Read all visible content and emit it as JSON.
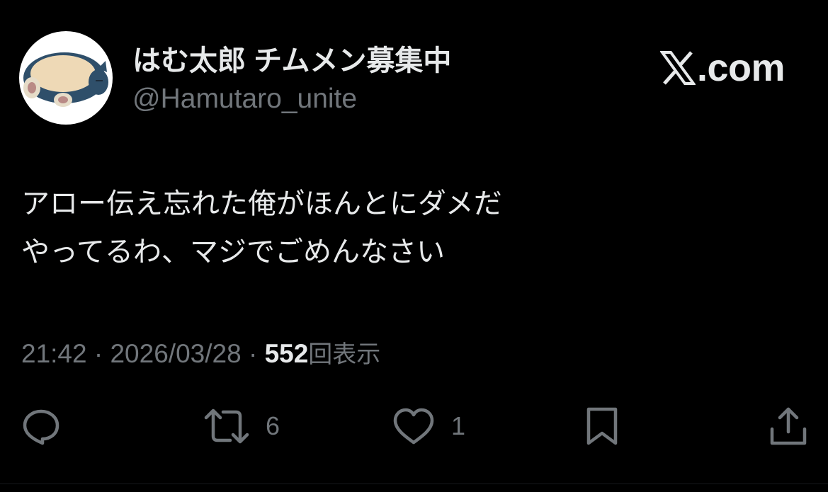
{
  "user": {
    "display_name": "はむ太郎 チムメン募集中",
    "handle": "@Hamutaro_unite",
    "avatar_icon": "snorlax-avatar"
  },
  "brand": {
    "text": ".com",
    "logo_icon": "x-logo-icon"
  },
  "tweet": {
    "lines": [
      "アロー伝え忘れた俺がほんとにダメだ",
      "やってるわ、マジでごめんなさい"
    ],
    "time": "21:42",
    "separator": "·",
    "date": "2026/03/28",
    "views_count": "552",
    "views_label": "回表示"
  },
  "actions": {
    "reply": {
      "icon": "reply-icon"
    },
    "retweet": {
      "icon": "retweet-icon",
      "count": "6"
    },
    "like": {
      "icon": "heart-icon",
      "count": "1"
    },
    "bookmark": {
      "icon": "bookmark-icon"
    },
    "share": {
      "icon": "share-icon"
    }
  },
  "colors": {
    "background": "#000000",
    "text_primary": "#e7e9ea",
    "text_secondary": "#71767b"
  }
}
